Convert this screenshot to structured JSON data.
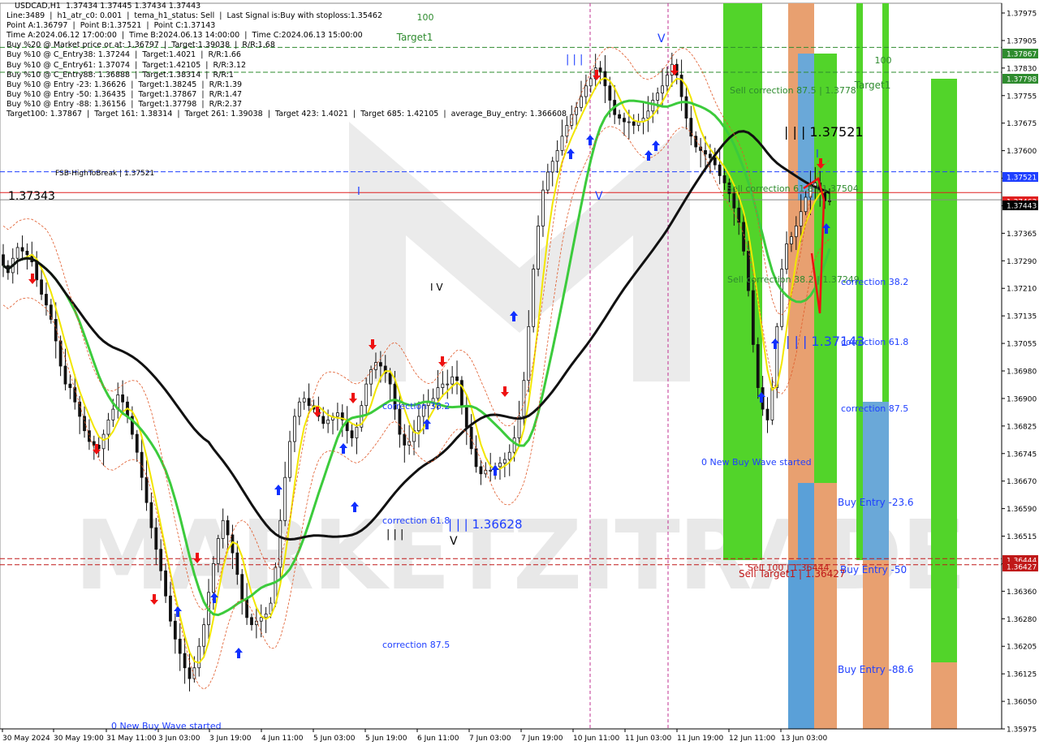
{
  "header": {
    "lines": [
      "USDCAD,H1  1.37434 1.37445 1.37434 1.37443",
      "Line:3489  |  h1_atr_c0: 0.001  |  tema_h1_status: Sell  |  Last Signal is:Buy with stoploss:1.35462",
      "Point A:1.36797  |  Point B:1.37521  |  Point C:1.37143",
      "Time A:2024.06.12 17:00:00  |  Time B:2024.06.13 14:00:00  |  Time C:2024.06.13 15:00:00",
      "Buy %20 @ Market price or at: 1.36797  |  Target:1.39038  |  R/R:1.68",
      "Buy %10 @ C_Entry38: 1.37244  |  Target:1.4021  |  R/R:1.66",
      "Buy %10 @ C_Entry61: 1.37074  |  Target:1.42105  |  R/R:3.12",
      "Buy %10 @ C_Entry88: 1.36888  |  Target:1.38314  |  R/R:1",
      "Buy %10 @ Entry -23: 1.36626  |  Target:1.38245  |  R/R:1.39",
      "Buy %10 @ Entry -50: 1.36435  |  Target:1.37867  |  R/R:1.47",
      "Buy %10 @ Entry -88: 1.36156  |  Target:1.37798  |  R/R:2.37",
      "Target100: 1.37867  |  Target 161: 1.38314  |  Target 261: 1.39038  |  Target 423: 1.4021  |  Target 685: 1.42105  |  average_Buy_entry: 1.366608"
    ]
  },
  "chart_data": {
    "type": "candlestick",
    "symbol": "USDCAD",
    "timeframe": "H1",
    "ylim": [
      1.3597,
      1.3799
    ],
    "y_ticks": [
      "1.37975",
      "1.37905",
      "1.37830",
      "1.37755",
      "1.37675",
      "1.37600",
      "1.37525",
      "1.37445",
      "1.37365",
      "1.37290",
      "1.37210",
      "1.37135",
      "1.37055",
      "1.36980",
      "1.36900",
      "1.36825",
      "1.36745",
      "1.36670",
      "1.36590",
      "1.36515",
      "1.36435",
      "1.36360",
      "1.36280",
      "1.36205",
      "1.36125",
      "1.36050",
      "1.35975"
    ],
    "x_ticks": [
      "30 May 2024",
      "30 May 19:00",
      "31 May 11:00",
      "3 Jun 03:00",
      "3 Jun 19:00",
      "4 Jun 11:00",
      "5 Jun 03:00",
      "5 Jun 19:00",
      "6 Jun 11:00",
      "7 Jun 03:00",
      "7 Jun 19:00",
      "10 Jun 11:00",
      "11 Jun 03:00",
      "11 Jun 19:00",
      "12 Jun 11:00",
      "13 Jun 03:00"
    ],
    "price_markers": [
      {
        "value": "1.37867",
        "color": "#2e8b2e"
      },
      {
        "value": "1.37798",
        "color": "#2e8b2e"
      },
      {
        "value": "1.37521",
        "color": "#1f3fff"
      },
      {
        "value": "1.37463",
        "color": "#e02020"
      },
      {
        "value": "1.37443",
        "color": "#000000"
      },
      {
        "value": "1.36444",
        "color": "#c01818"
      },
      {
        "value": "1.36427",
        "color": "#c01818"
      }
    ],
    "h_lines": [
      {
        "value": 1.37867,
        "color": "#2e8b2e",
        "style": "dashed"
      },
      {
        "value": 1.37798,
        "color": "#2e8b2e",
        "style": "dashed"
      },
      {
        "value": 1.37521,
        "color": "#1f3fff",
        "style": "dashed"
      },
      {
        "value": 1.37463,
        "color": "#e02020",
        "style": "solid"
      },
      {
        "value": 1.37443,
        "color": "#888888",
        "style": "solid"
      },
      {
        "value": 1.36444,
        "color": "#c01818",
        "style": "dashed"
      },
      {
        "value": 1.36427,
        "color": "#c01818",
        "style": "dashed"
      }
    ],
    "annotations": [
      {
        "text": "100",
        "color": "#2e8b2e"
      },
      {
        "text": "Target1",
        "color": "#2e8b2e"
      },
      {
        "text": "100",
        "color": "#2e8b2e"
      },
      {
        "text": "Target1",
        "color": "#2e8b2e"
      },
      {
        "text": "FSB-HighToBreak | 1.37521",
        "color": "#000000"
      },
      {
        "text": "1.37343",
        "color": "#000000"
      },
      {
        "text": "Sell correction 87.5 | 1.3778",
        "color": "#2e8b2e"
      },
      {
        "text": "| | | 1.37521",
        "color": "#000000"
      },
      {
        "text": "Sell correction 61.8 | 1.37504",
        "color": "#2e8b2e"
      },
      {
        "text": "Sell correction 38.2 | 1.37249",
        "color": "#2e8b2e"
      },
      {
        "text": "| | | 1.37143",
        "color": "#1f3fff"
      },
      {
        "text": "correction 38.2",
        "color": "#1f3fff"
      },
      {
        "text": "correction 61.8",
        "color": "#1f3fff"
      },
      {
        "text": "correction 87.5",
        "color": "#1f3fff"
      },
      {
        "text": "0 New Buy Wave started",
        "color": "#1f3fff"
      },
      {
        "text": "Buy Entry -23.6",
        "color": "#1f3fff"
      },
      {
        "text": "Buy Entry -50",
        "color": "#1f3fff"
      },
      {
        "text": "Buy Entry -88.6",
        "color": "#1f3fff"
      },
      {
        "text": "Sell 100 | 1.36444",
        "color": "#c01818"
      },
      {
        "text": "Sell Target1 | 1.36427",
        "color": "#c01818"
      },
      {
        "text": "correction 38.2",
        "color": "#1f3fff"
      },
      {
        "text": "correction 61.8",
        "color": "#1f3fff"
      },
      {
        "text": "correction 87.5",
        "color": "#1f3fff"
      },
      {
        "text": "| | | 1.36628",
        "color": "#1f3fff"
      },
      {
        "text": "0 New Buy Wave started",
        "color": "#1f3fff"
      },
      {
        "text": "I V",
        "color": "#000000"
      },
      {
        "text": "| | |",
        "color": "#000000"
      },
      {
        "text": "V",
        "color": "#000000"
      },
      {
        "text": "I",
        "color": "#1f3fff"
      },
      {
        "text": "| | |",
        "color": "#1f3fff"
      },
      {
        "text": "V",
        "color": "#1f3fff"
      },
      {
        "text": "V",
        "color": "#1f3fff"
      },
      {
        "text": "I",
        "color": "#1f3fff"
      }
    ],
    "watermark": "MARKETZITRADE",
    "close_series": [
      1.3726,
      1.3724,
      1.3728,
      1.3731,
      1.373,
      1.3729,
      1.3727,
      1.3722,
      1.3718,
      1.3715,
      1.3711,
      1.3705,
      1.3698,
      1.3693,
      1.3692,
      1.3688,
      1.3684,
      1.368,
      1.3677,
      1.3676,
      1.3675,
      1.3679,
      1.3683,
      1.3686,
      1.369,
      1.3688,
      1.3684,
      1.3679,
      1.3674,
      1.3667,
      1.366,
      1.3653,
      1.3647,
      1.3641,
      1.3634,
      1.3627,
      1.3622,
      1.3618,
      1.3614,
      1.3611,
      1.3614,
      1.362,
      1.3626,
      1.3635,
      1.3643,
      1.365,
      1.3655,
      1.3651,
      1.3646,
      1.364,
      1.3633,
      1.3628,
      1.3626,
      1.3627,
      1.3628,
      1.3629,
      1.3632,
      1.3642,
      1.3655,
      1.3667,
      1.3677,
      1.3684,
      1.3688,
      1.3689,
      1.3687,
      1.3686,
      1.3684,
      1.3682,
      1.3683,
      1.3684,
      1.3685,
      1.3683,
      1.368,
      1.3678,
      1.3681,
      1.3687,
      1.3693,
      1.3697,
      1.3699,
      1.3698,
      1.3696,
      1.3693,
      1.3686,
      1.3679,
      1.3676,
      1.3677,
      1.368,
      1.3684,
      1.3687,
      1.3688,
      1.3689,
      1.3692,
      1.3693,
      1.3693,
      1.3695,
      1.3694,
      1.3687,
      1.3681,
      1.3675,
      1.367,
      1.3668,
      1.3669,
      1.3669,
      1.367,
      1.3671,
      1.3672,
      1.3674,
      1.3678,
      1.3684,
      1.3694,
      1.3709,
      1.3725,
      1.3737,
      1.3747,
      1.3752,
      1.3755,
      1.3758,
      1.3762,
      1.3765,
      1.3768,
      1.377,
      1.3773,
      1.3776,
      1.3778,
      1.3781,
      1.378,
      1.3776,
      1.3772,
      1.3768,
      1.3767,
      1.3766,
      1.3766,
      1.3765,
      1.3766,
      1.3767,
      1.3769,
      1.3772,
      1.3774,
      1.3776,
      1.3779,
      1.3782,
      1.3779,
      1.3773,
      1.3767,
      1.3762,
      1.3759,
      1.3758,
      1.3757,
      1.3756,
      1.3754,
      1.3751,
      1.3749,
      1.3746,
      1.3742,
      1.3738,
      1.373,
      1.3719,
      1.3704,
      1.3692,
      1.3686,
      1.3683,
      1.3692,
      1.3709,
      1.3725,
      1.3732,
      1.3734,
      1.3737,
      1.3741,
      1.3745,
      1.3748,
      1.3749,
      1.3747,
      1.3744,
      1.3744
    ]
  }
}
